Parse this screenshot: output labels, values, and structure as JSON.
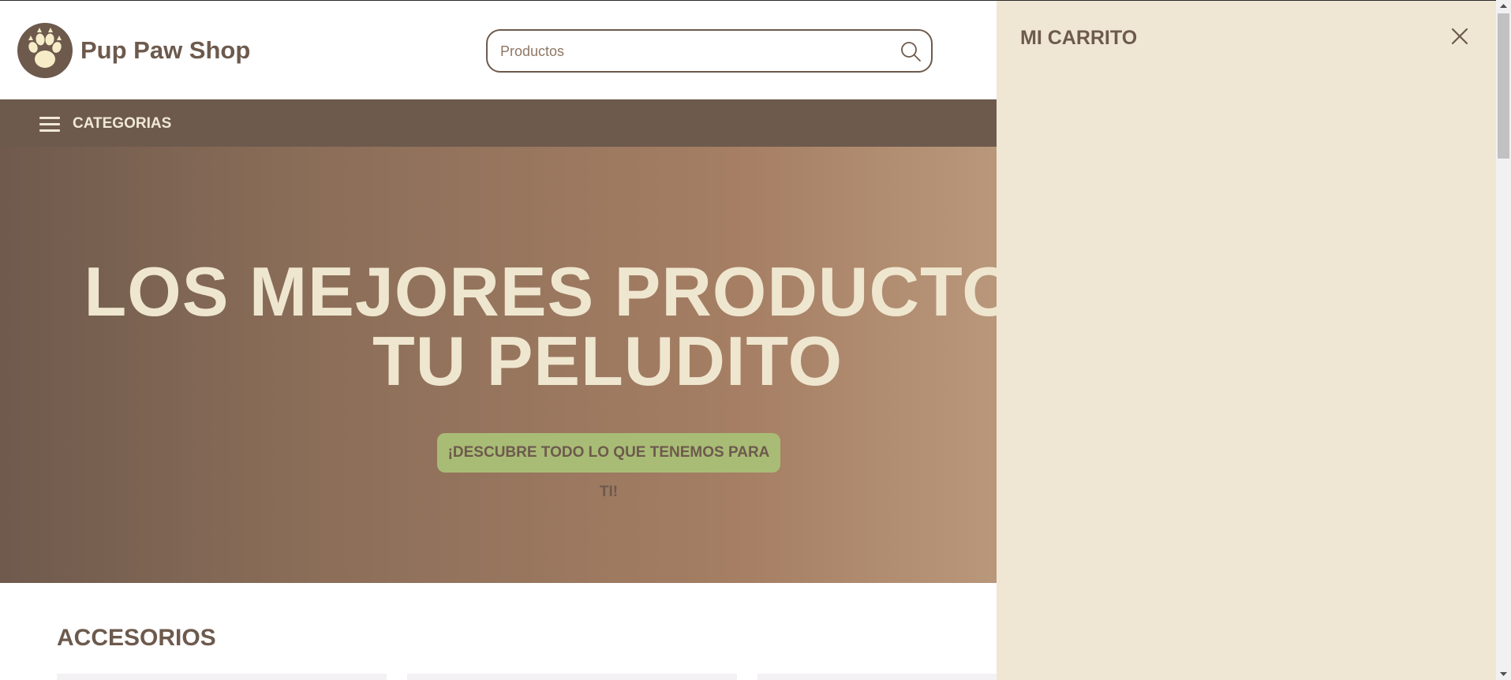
{
  "header": {
    "brand_name": "Pup Paw Shop",
    "search_placeholder": "Productos"
  },
  "navbar": {
    "categories_label": "CATEGORIAS"
  },
  "hero": {
    "title_line1": "LOS MEJORES PRODUCTOS P",
    "title_line2": "TU PELUDITO",
    "cta_label": "¡DESCUBRE TODO LO QUE TENEMOS PARA TI!"
  },
  "section": {
    "title": "ACCESORIOS"
  },
  "cart": {
    "title": "MI CARRITO"
  },
  "icons": {
    "logo": "paw-icon",
    "search": "search-icon",
    "menu": "hamburger-menu-icon",
    "close": "close-icon"
  },
  "colors": {
    "brand_brown": "#6d5a4d",
    "cream": "#efe7d3",
    "cta_green": "#a9bc76"
  }
}
